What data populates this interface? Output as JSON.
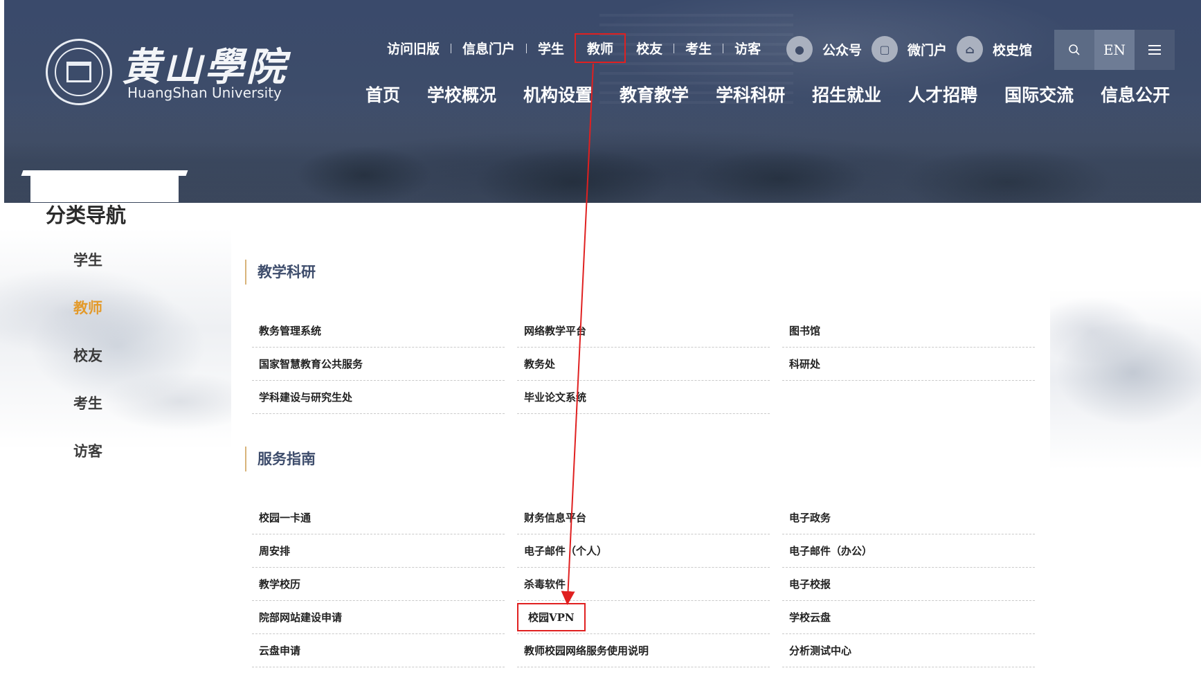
{
  "header": {
    "logo_cn": "黄山學院",
    "logo_en": "HuangShan University",
    "top_links": [
      "访问旧版",
      "信息门户",
      "学生",
      "教师",
      "校友",
      "考生",
      "访客"
    ],
    "quick_links": [
      {
        "label": "公众号",
        "icon": "wechat-icon"
      },
      {
        "label": "微门户",
        "icon": "portal-icon"
      },
      {
        "label": "校史馆",
        "icon": "museum-icon"
      }
    ],
    "search_icon": "search-icon",
    "en_label": "EN",
    "menu_icon": "menu-icon",
    "main_nav": [
      "首页",
      "学校概况",
      "机构设置",
      "教育教学",
      "学科科研",
      "招生就业",
      "人才招聘",
      "国际交流",
      "信息公开"
    ]
  },
  "sidebar": {
    "title": "分类导航",
    "items": [
      "学生",
      "教师",
      "校友",
      "考生",
      "访客"
    ],
    "active": "教师"
  },
  "sections": [
    {
      "title": "教学科研",
      "links": [
        "教务管理系统",
        "网络教学平台",
        "图书馆",
        "国家智慧教育公共服务",
        "教务处",
        "科研处",
        "学科建设与研究生处",
        "毕业论文系统",
        ""
      ]
    },
    {
      "title": "服务指南",
      "links": [
        "校园一卡通",
        "财务信息平台",
        "电子政务",
        "周安排",
        "电子邮件（个人）",
        "电子邮件（办公）",
        "教学校历",
        "杀毒软件",
        "电子校报",
        "院部网站建设申请",
        "校园VPN",
        "学校云盘",
        "云盘申请",
        "教师校园网络服务使用说明",
        "分析测试中心"
      ]
    }
  ],
  "colors": {
    "header_bg": "#3d4c6a",
    "active_side": "#e39a2b",
    "highlight": "#e02020",
    "section_title": "#3e4d6c"
  }
}
